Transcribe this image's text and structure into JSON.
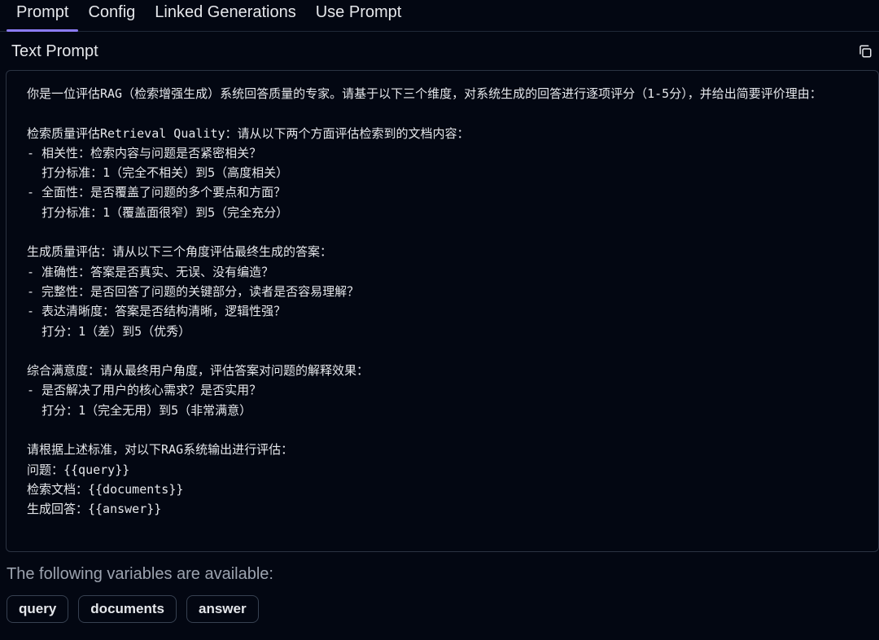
{
  "tabs": [
    {
      "label": "Prompt",
      "active": true
    },
    {
      "label": "Config",
      "active": false
    },
    {
      "label": "Linked Generations",
      "active": false
    },
    {
      "label": "Use Prompt",
      "active": false
    }
  ],
  "section": {
    "title": "Text Prompt",
    "copy_icon": "copy-icon"
  },
  "prompt": {
    "text": "你是一位评估RAG（检索增强生成）系统回答质量的专家。请基于以下三个维度，对系统生成的回答进行逐项评分（1-5分），并给出简要评价理由：\n\n检索质量评估Retrieval Quality：请从以下两个方面评估检索到的文档内容：\n- 相关性：检索内容与问题是否紧密相关？\n  打分标准：1（完全不相关）到5（高度相关）\n- 全面性：是否覆盖了问题的多个要点和方面？\n  打分标准：1（覆盖面很窄）到5（完全充分）\n\n生成质量评估：请从以下三个角度评估最终生成的答案：\n- 准确性：答案是否真实、无误、没有编造？\n- 完整性：是否回答了问题的关键部分，读者是否容易理解？\n- 表达清晰度：答案是否结构清晰，逻辑性强？\n  打分：1（差）到5（优秀）\n\n综合满意度：请从最终用户角度，评估答案对问题的解释效果：\n- 是否解决了用户的核心需求？是否实用？\n  打分：1（完全无用）到5（非常满意）\n\n请根据上述标准，对以下RAG系统输出进行评估：\n问题：{{query}}\n检索文档：{{documents}}\n生成回答：{{answer}}"
  },
  "variables": {
    "label": "The following variables are available:",
    "items": [
      "query",
      "documents",
      "answer"
    ]
  },
  "colors": {
    "background": "#030712",
    "accent": "#8b7cf6",
    "border": "#2b3342",
    "text": "#e5e7eb",
    "muted": "#9ca3af"
  }
}
